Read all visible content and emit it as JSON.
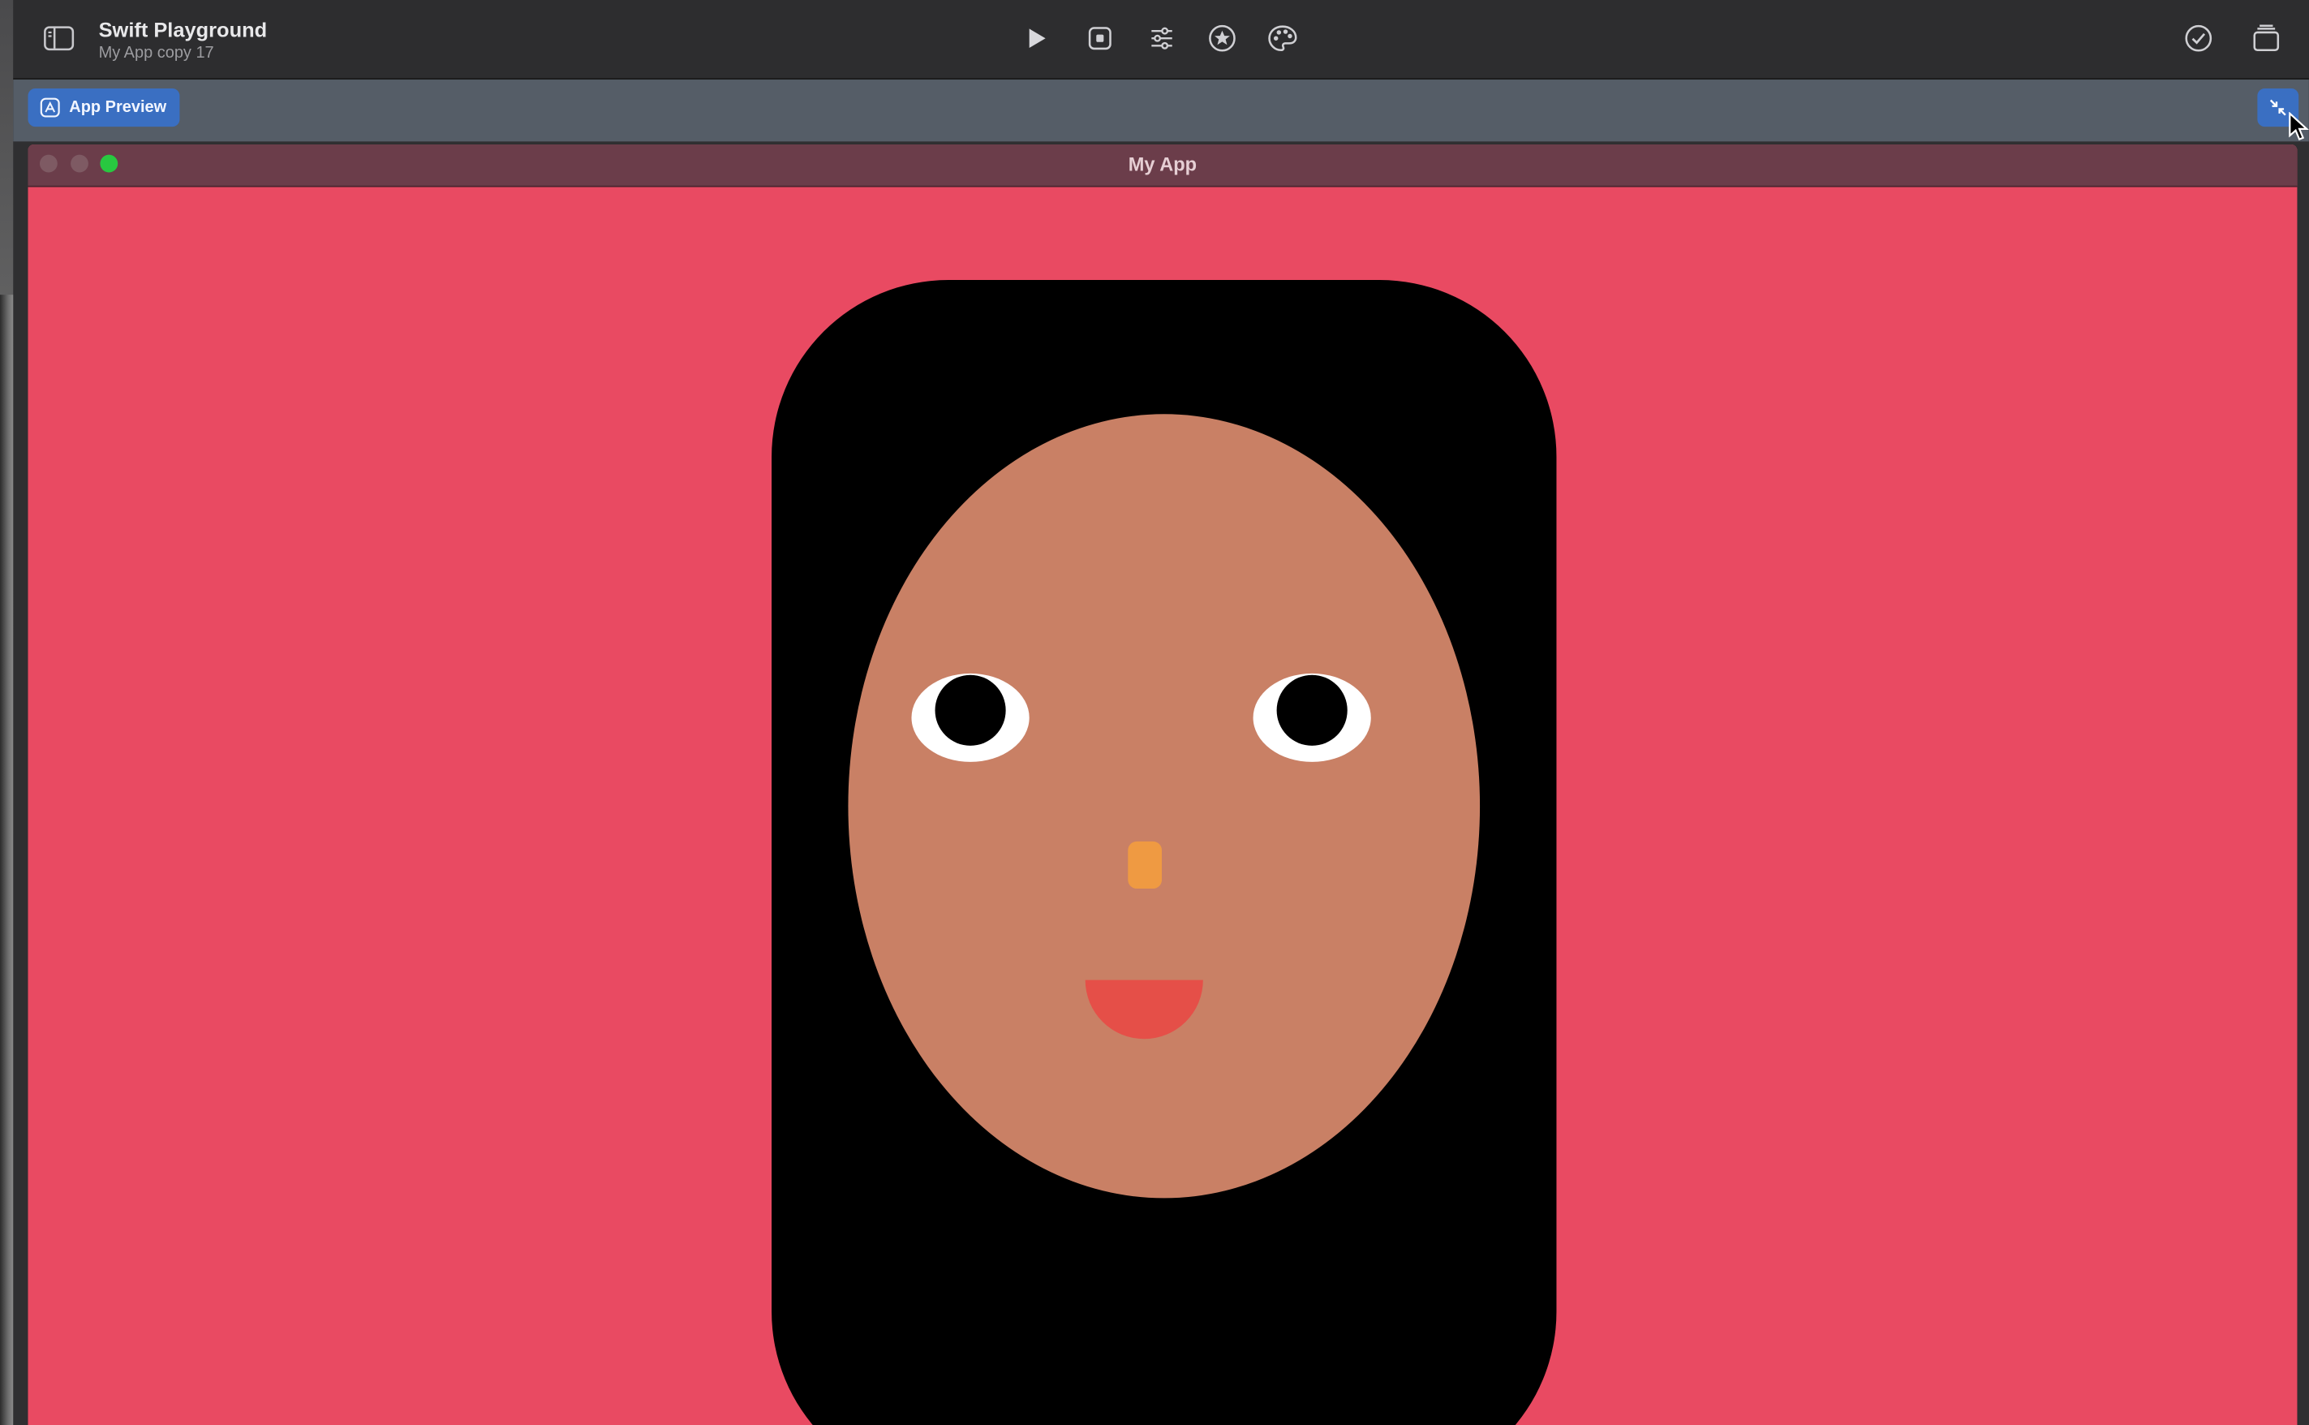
{
  "toolbar": {
    "title": "Swift Playground",
    "subtitle": "My App copy 17",
    "icons": [
      "sidebar-toggle-icon",
      "play-icon",
      "stop-icon",
      "sliders-icon",
      "star-icon",
      "palette-icon",
      "checkmark-circle-icon",
      "library-icon"
    ]
  },
  "subbar": {
    "app_preview_label": "App Preview"
  },
  "preview": {
    "window_title": "My App"
  },
  "colors": {
    "background": "#e94a62",
    "hair": "#000000",
    "skin": "#c98065",
    "nose": "#ef9a42",
    "mouth": "#e54f48",
    "accent": "#3a6fc2"
  }
}
